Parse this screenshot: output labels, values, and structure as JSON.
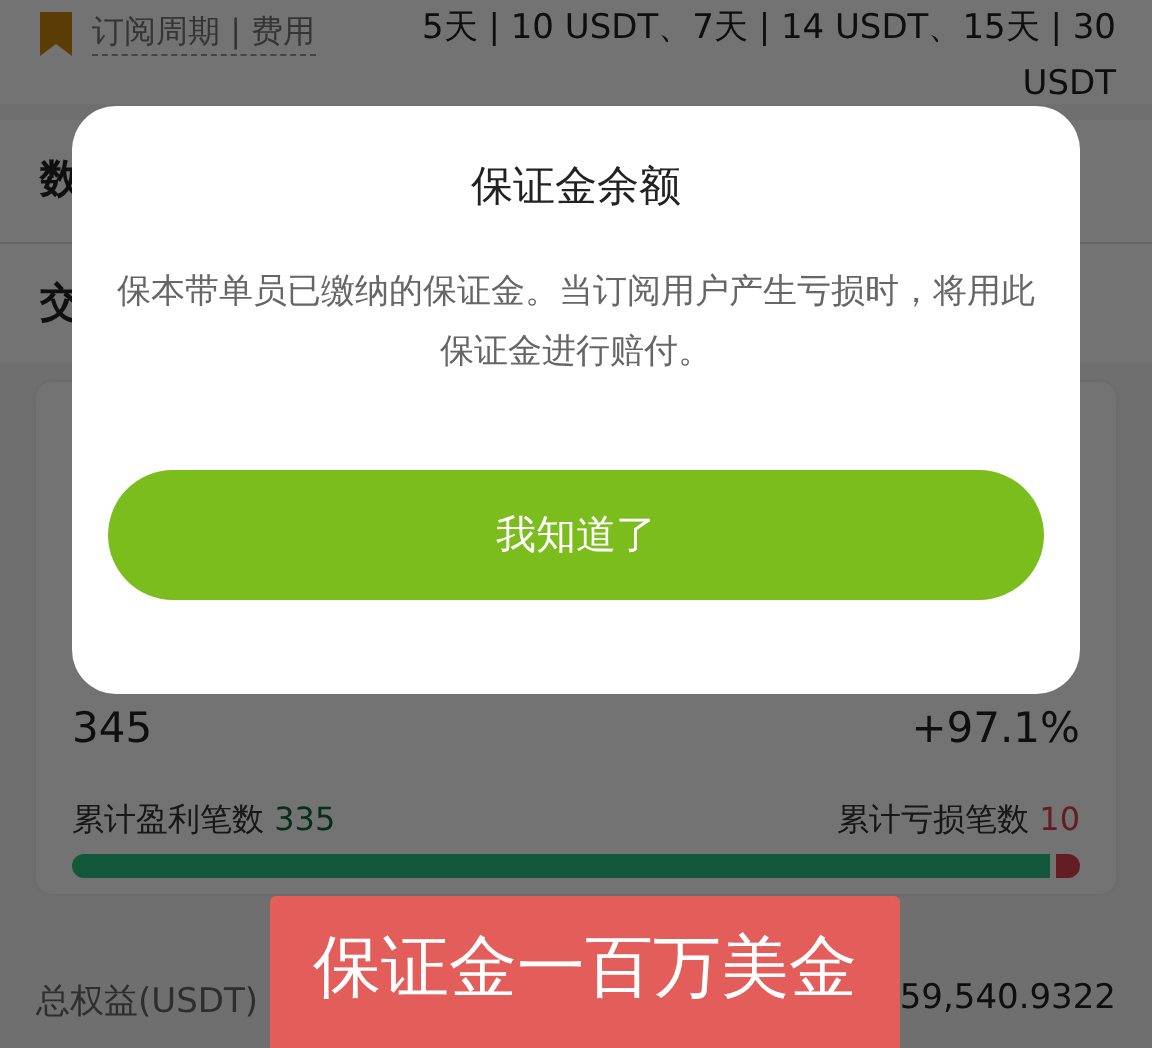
{
  "header": {
    "label": "订阅周期 | 费用",
    "value": "5天 | 10 USDT、7天 | 14 USDT、15天 | 30 USDT"
  },
  "section_titles": [
    "数",
    "交"
  ],
  "stats": {
    "count": "345",
    "rate": "+97.1%",
    "win_label": "累计盈利笔数",
    "win_count": "335",
    "loss_label": "累计亏损笔数",
    "loss_count": "10",
    "level": 0.971
  },
  "equity": {
    "label": "总权益(USDT)",
    "value": "59,540.9322"
  },
  "dialog": {
    "title": "保证金余额",
    "message": "保本带单员已缴纳的保证金。当订阅用户产生亏损时，将用此保证金进行赔付。",
    "button": "我知道了"
  },
  "caption": "保证金一百万美金"
}
